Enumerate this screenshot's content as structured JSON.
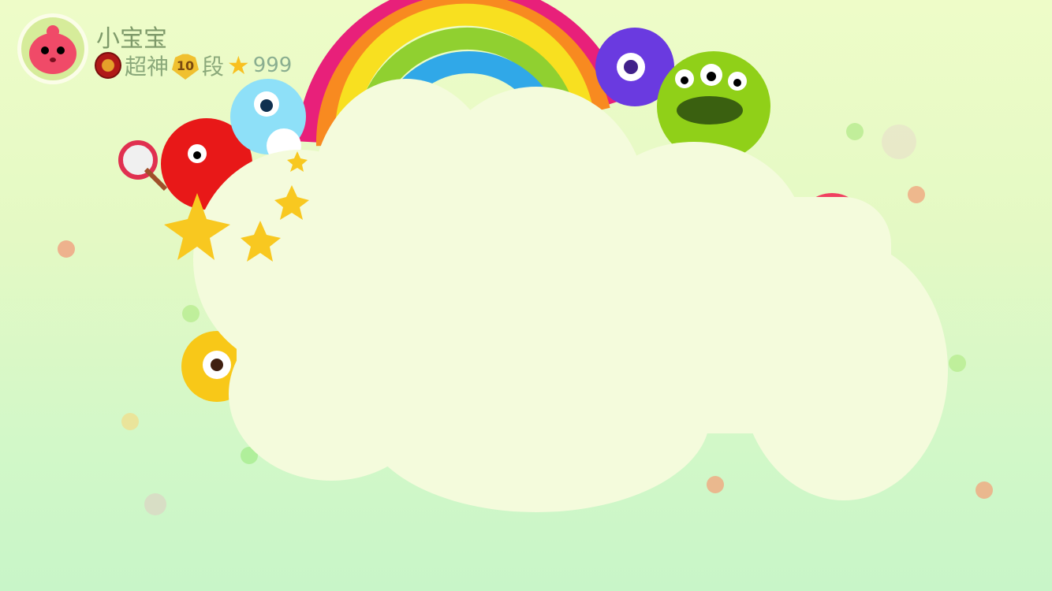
{
  "player": {
    "name": "小宝宝",
    "title": "超神",
    "rank_level": "10",
    "rank_suffix": "段",
    "stars": "999"
  },
  "colors": {
    "cloud": "#f4fbdc",
    "text": "#7e9a6a"
  }
}
